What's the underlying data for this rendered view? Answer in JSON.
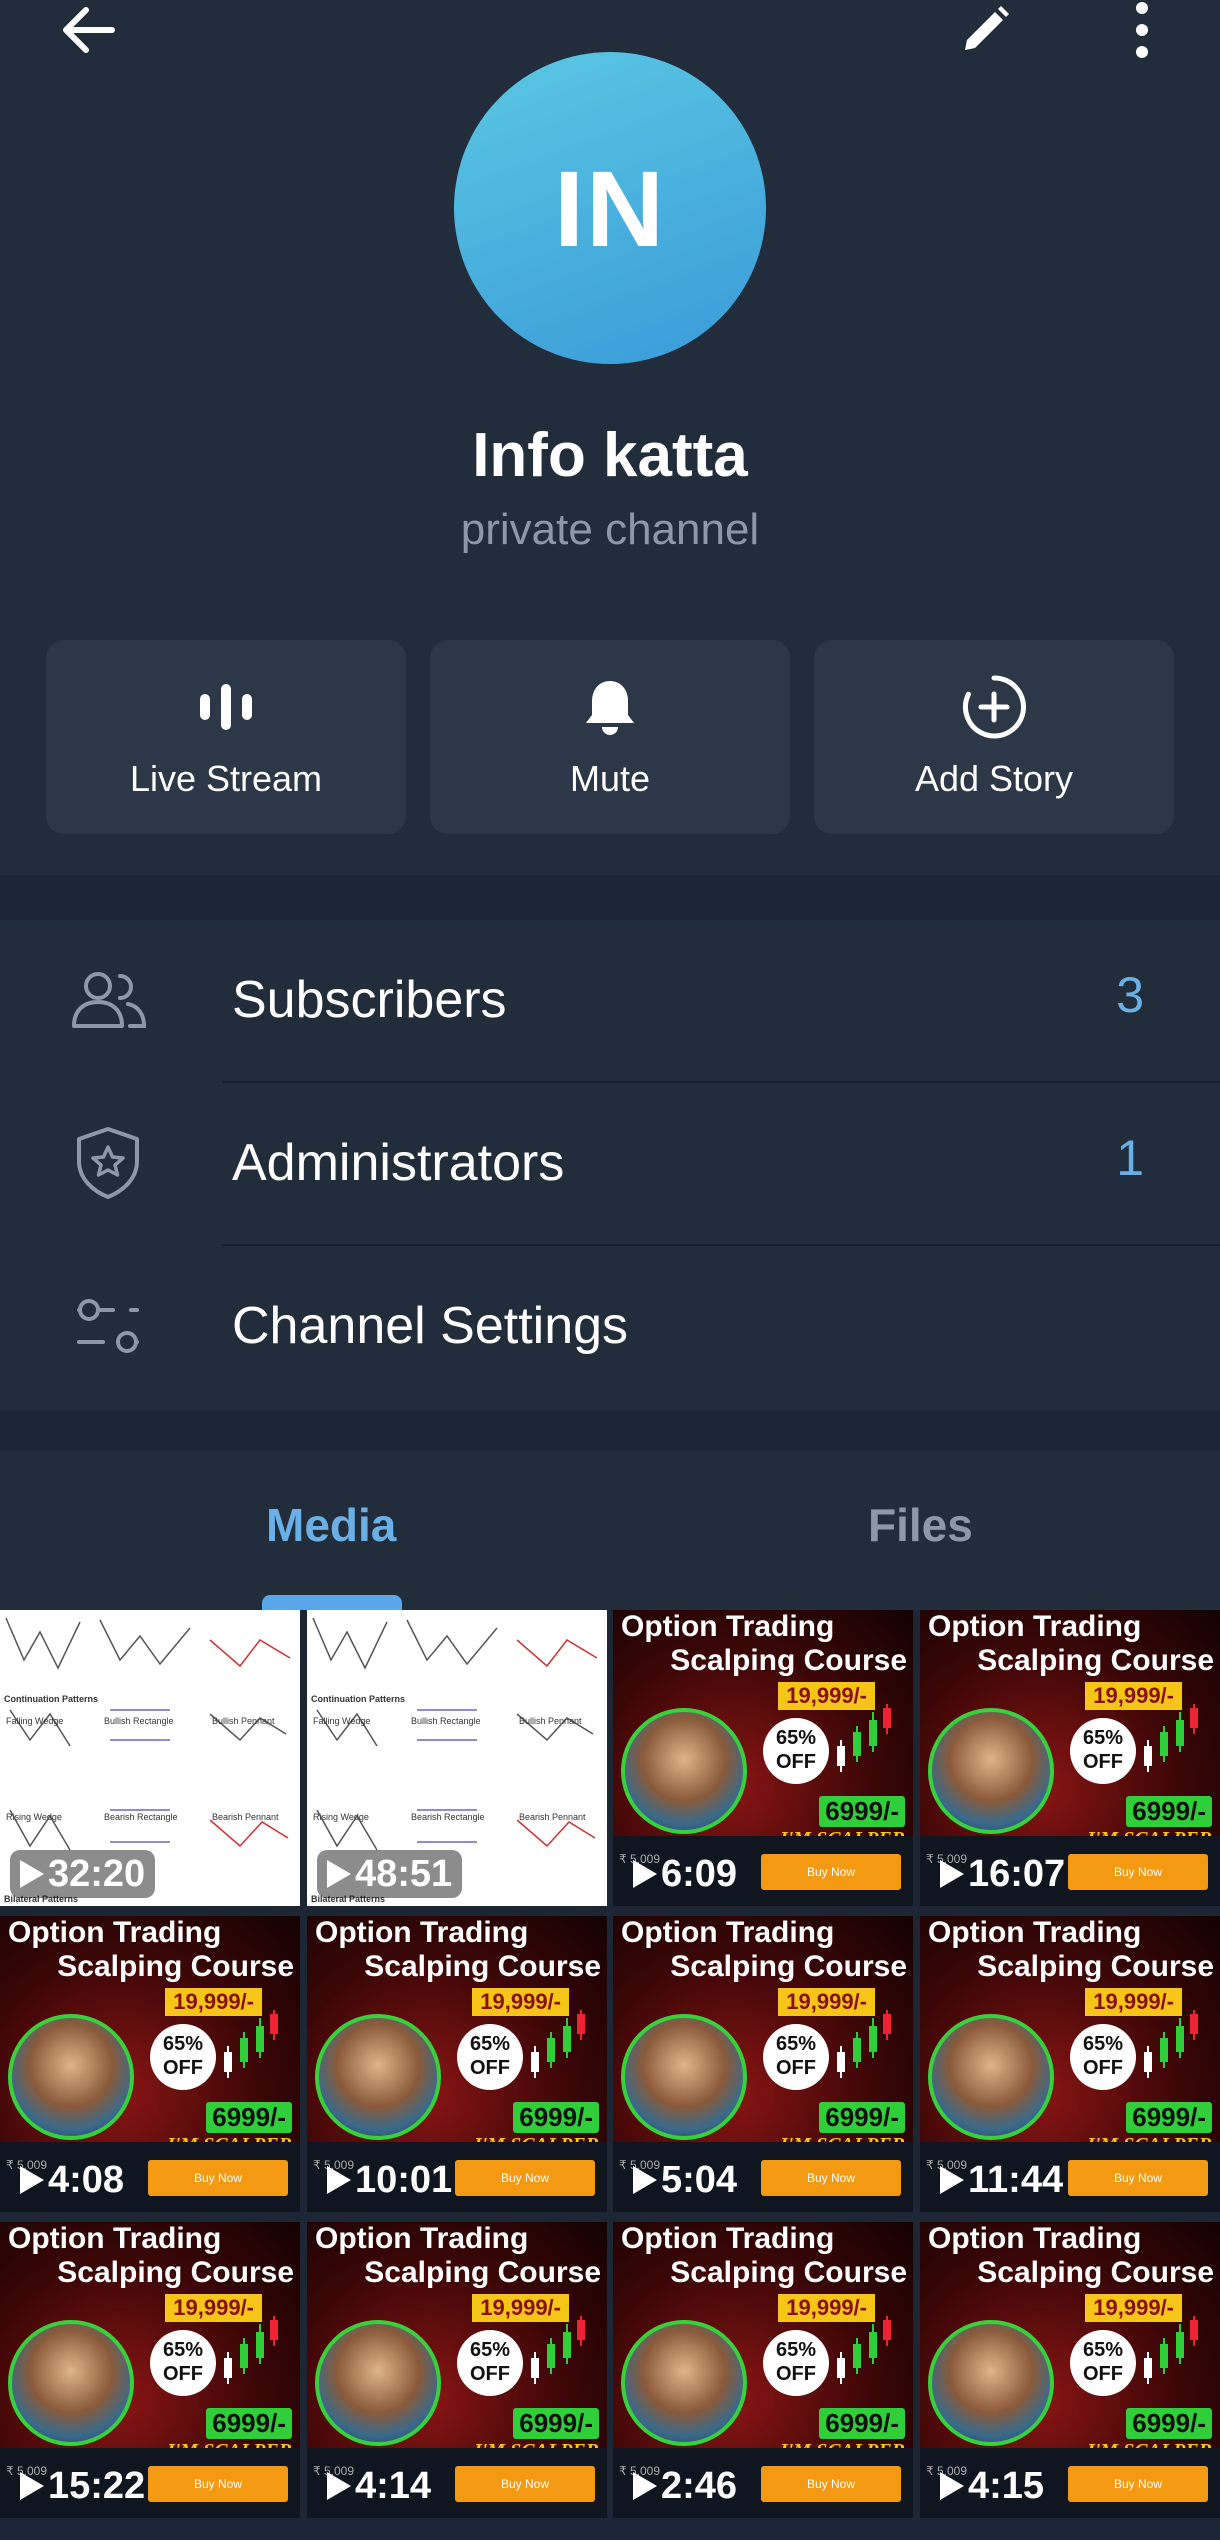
{
  "header": {
    "avatar_initials": "IN",
    "channel_name": "Info katta",
    "channel_type": "private channel"
  },
  "actions": [
    {
      "label": "Live Stream",
      "icon": "live-stream-icon"
    },
    {
      "label": "Mute",
      "icon": "bell-icon"
    },
    {
      "label": "Add Story",
      "icon": "add-story-icon"
    }
  ],
  "info_rows": [
    {
      "label": "Subscribers",
      "value": "3",
      "icon": "users-icon"
    },
    {
      "label": "Administrators",
      "value": "1",
      "icon": "shield-star-icon"
    },
    {
      "label": "Channel Settings",
      "value": "",
      "icon": "sliders-icon"
    }
  ],
  "tabs": [
    {
      "label": "Media",
      "active": true
    },
    {
      "label": "Files",
      "active": false
    }
  ],
  "chart_thumb": {
    "heading": "Continuation Patterns",
    "labels": [
      "Falling Wedge",
      "Bullish Rectangle",
      "Bullish Pennant",
      "Rising Wedge",
      "Bearish Rectangle",
      "Bearish Pennant"
    ],
    "footer": "Bilateral Patterns"
  },
  "course_thumb": {
    "title_line1": "Option Trading",
    "title_line2": "Scalping Course",
    "price": "19,999/-",
    "discount": "65% OFF",
    "sale_price": "6999/-",
    "tagline": "I'M SCALPER",
    "buy_label": "Buy Now",
    "mrp": "₹ 5,009"
  },
  "media": [
    {
      "type": "chart",
      "duration": "32:20"
    },
    {
      "type": "chart",
      "duration": "48:51"
    },
    {
      "type": "course",
      "duration": "6:09"
    },
    {
      "type": "course",
      "duration": "16:07"
    },
    {
      "type": "course",
      "duration": "4:08"
    },
    {
      "type": "course",
      "duration": "10:01"
    },
    {
      "type": "course",
      "duration": "5:04"
    },
    {
      "type": "course",
      "duration": "11:44"
    },
    {
      "type": "course",
      "duration": "15:22"
    },
    {
      "type": "course",
      "duration": "4:14"
    },
    {
      "type": "course",
      "duration": "2:46"
    },
    {
      "type": "course",
      "duration": "4:15"
    }
  ],
  "colors": {
    "background": "#1c2634",
    "surface": "#212d3b",
    "button": "#2c3848",
    "accent": "#5aa8ea",
    "muted": "#8e99a7"
  }
}
